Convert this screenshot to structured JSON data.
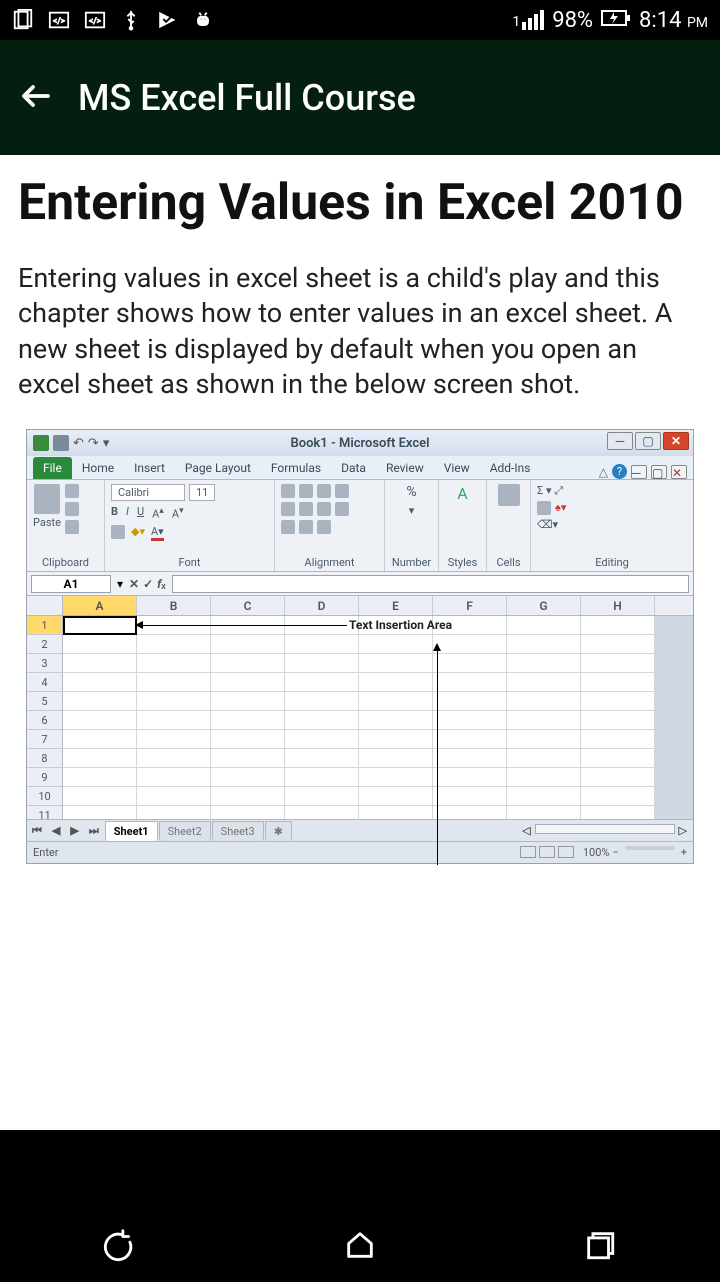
{
  "status_bar": {
    "battery_pct": "98%",
    "time": "8:14",
    "ampm": "PM",
    "signal_prefix": "1"
  },
  "app_header": {
    "title": "MS Excel Full Course"
  },
  "content": {
    "heading": "Entering Values in Excel 2010",
    "paragraph": "Entering values in excel sheet is a child's play and this chapter shows how to enter values in an excel sheet. A new sheet is displayed by default when you open an excel sheet as shown in the below screen shot."
  },
  "excel": {
    "window_title": "Book1 - Microsoft Excel",
    "tabs": {
      "file": "File",
      "home": "Home",
      "insert": "Insert",
      "page_layout": "Page Layout",
      "formulas": "Formulas",
      "data": "Data",
      "review": "Review",
      "view": "View",
      "addins": "Add-Ins"
    },
    "groups": {
      "clipboard": "Clipboard",
      "font": "Font",
      "alignment": "Alignment",
      "number": "Number",
      "styles": "Styles",
      "cells": "Cells",
      "editing": "Editing",
      "paste": "Paste",
      "font_name": "Calibri",
      "font_size": "11",
      "percent": "%"
    },
    "name_box": "A1",
    "columns": [
      "A",
      "B",
      "C",
      "D",
      "E",
      "F",
      "G",
      "H"
    ],
    "rows": [
      "1",
      "2",
      "3",
      "4",
      "5",
      "6",
      "7",
      "8",
      "9",
      "10",
      "11"
    ],
    "annotations": {
      "text_insertion": "Text Insertion Area"
    },
    "sheets": [
      "Sheet1",
      "Sheet2",
      "Sheet3"
    ],
    "status": "Enter",
    "zoom": "100%"
  }
}
